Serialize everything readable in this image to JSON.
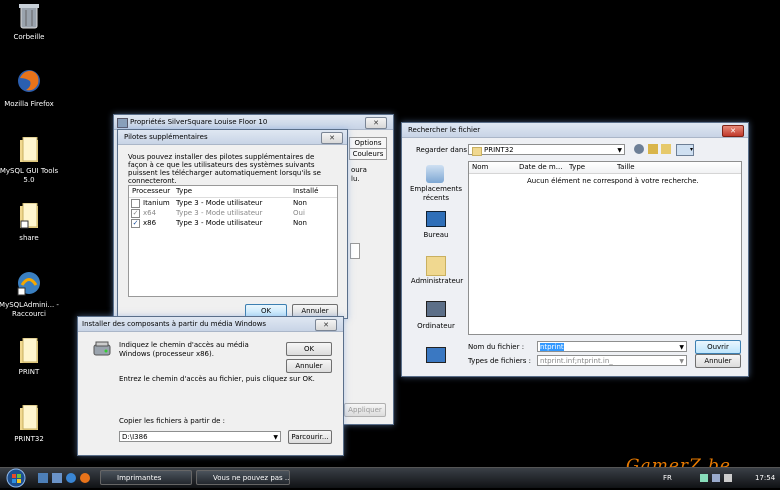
{
  "desktop": {
    "icons": [
      {
        "label": "Corbeille"
      },
      {
        "label": "Mozilla Firefox"
      },
      {
        "label": "MySQL GUI Tools 5.0"
      },
      {
        "label": "share"
      },
      {
        "label": "MySQLAdmini... - Raccourci"
      },
      {
        "label": "PRINT"
      },
      {
        "label": "PRINT32"
      }
    ],
    "watermark": "GamerZ.be"
  },
  "props_window": {
    "title": "Propriétés SilverSquare Louise Floor 10",
    "close": "✕",
    "tabs": [
      "Options",
      "Couleurs"
    ],
    "partial_text_1": "oura",
    "partial_text_2": "lu.",
    "apply": "Appliquer"
  },
  "drivers_dialog": {
    "title": "Pilotes supplémentaires",
    "close": "✕",
    "description": "Vous pouvez installer des pilotes supplémentaires de façon à ce que les utilisateurs des systèmes suivants puissent les télécharger automatiquement lorsqu'ils se connecteront.",
    "columns": [
      "Processeur",
      "Type",
      "Installé"
    ],
    "rows": [
      {
        "checked": false,
        "processor": "Itanium",
        "type": "Type 3 - Mode utilisateur",
        "installed": "Non",
        "disabled": false
      },
      {
        "checked": true,
        "processor": "x64",
        "type": "Type 3 - Mode utilisateur",
        "installed": "Oui",
        "disabled": true
      },
      {
        "checked": true,
        "processor": "x86",
        "type": "Type 3 - Mode utilisateur",
        "installed": "Non",
        "disabled": false
      }
    ],
    "ok": "OK",
    "cancel": "Annuler"
  },
  "install_dialog": {
    "title": "Installer des composants à partir du média Windows",
    "close": "✕",
    "prompt": "Indiquez le chemin d'accès au média Windows (processeur x86).",
    "instruction": "Entrez le chemin d'accès au fichier, puis cliquez sur OK.",
    "copy_label": "Copier les fichiers à partir de :",
    "path_value": "D:\\I386",
    "ok": "OK",
    "cancel": "Annuler",
    "browse": "Parcourir..."
  },
  "file_dialog": {
    "title": "Rechercher le fichier",
    "close": "✕",
    "look_in_label": "Regarder dans :",
    "look_in_value": "PRINT32",
    "places": [
      {
        "label": "Emplacements récents"
      },
      {
        "label": "Bureau"
      },
      {
        "label": "Administrateur"
      },
      {
        "label": "Ordinateur"
      }
    ],
    "columns": [
      "Nom",
      "Date de m...",
      "Type",
      "Taille"
    ],
    "empty_message": "Aucun élément ne correspond à votre recherche.",
    "filename_label": "Nom du fichier :",
    "filename_value": "ntprint",
    "filetypes_label": "Types de fichiers :",
    "filetypes_value": "ntprint.inf;ntprint.in_",
    "open": "Ouvrir",
    "cancel": "Annuler"
  },
  "taskbar": {
    "buttons": [
      {
        "label": "Imprimantes"
      },
      {
        "label": "Vous ne pouvez pas ..."
      }
    ],
    "lang": "FR",
    "time": "17:54"
  }
}
